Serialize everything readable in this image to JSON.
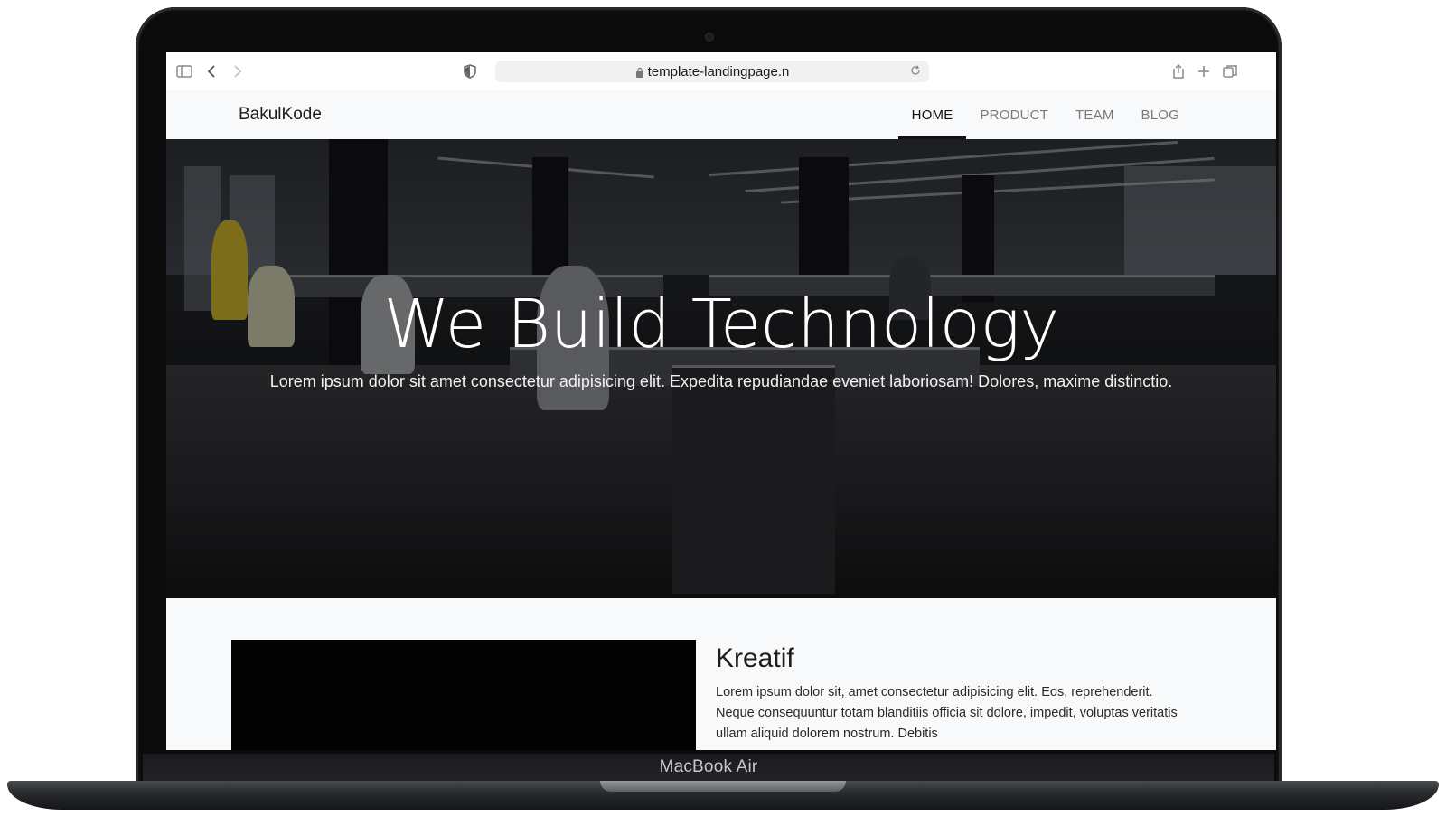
{
  "device": {
    "label": "MacBook Air"
  },
  "browser": {
    "url": "template-landingpage.n",
    "icons": [
      "sidebar-icon",
      "back-icon",
      "forward-icon",
      "shield-icon",
      "lock-icon",
      "reload-icon",
      "share-icon",
      "new-tab-icon",
      "tabs-icon"
    ]
  },
  "site": {
    "brand": "BakulKode",
    "nav": [
      {
        "label": "HOME",
        "active": true
      },
      {
        "label": "PRODUCT",
        "active": false
      },
      {
        "label": "TEAM",
        "active": false
      },
      {
        "label": "BLOG",
        "active": false
      }
    ],
    "hero": {
      "title": "We Build Technology",
      "subtitle": "Lorem ipsum dolor sit amet consectetur adipisicing elit. Expedita repudiandae eveniet laboriosam! Dolores, maxime distinctio."
    },
    "feature": {
      "title": "Kreatif",
      "text": "Lorem ipsum dolor sit, amet consectetur adipisicing elit. Eos, reprehenderit. Neque consequuntur totam blanditiis officia sit dolore, impedit, voluptas veritatis ullam aliquid dolorem nostrum. Debitis"
    }
  }
}
